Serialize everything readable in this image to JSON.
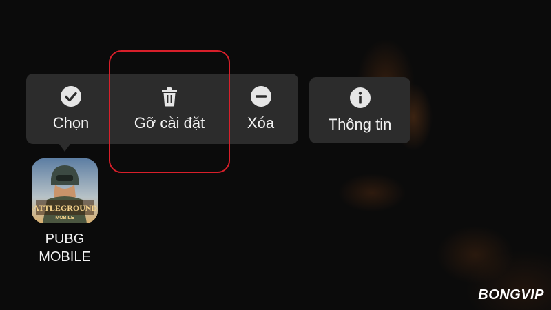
{
  "context_menu": {
    "items": [
      {
        "label": "Chọn",
        "icon": "check-circle-icon"
      },
      {
        "label": "Gỡ cài đặt",
        "icon": "trash-icon"
      },
      {
        "label": "Xóa",
        "icon": "minus-circle-icon"
      },
      {
        "label": "Thông tin",
        "icon": "info-circle-icon"
      }
    ],
    "highlighted_item": "Gỡ cài đặt"
  },
  "app": {
    "name_line1": "PUBG",
    "name_line2": "MOBILE",
    "icon_text": "BATTLEGROUNDS",
    "icon_subtext": "MOBILE"
  },
  "watermark": "BONGVIP",
  "colors": {
    "menu_background": "#2c2c2c",
    "menu_text": "#f2f2f2",
    "highlight_border": "#d81f2a",
    "screen_background": "#0b0b0b"
  }
}
